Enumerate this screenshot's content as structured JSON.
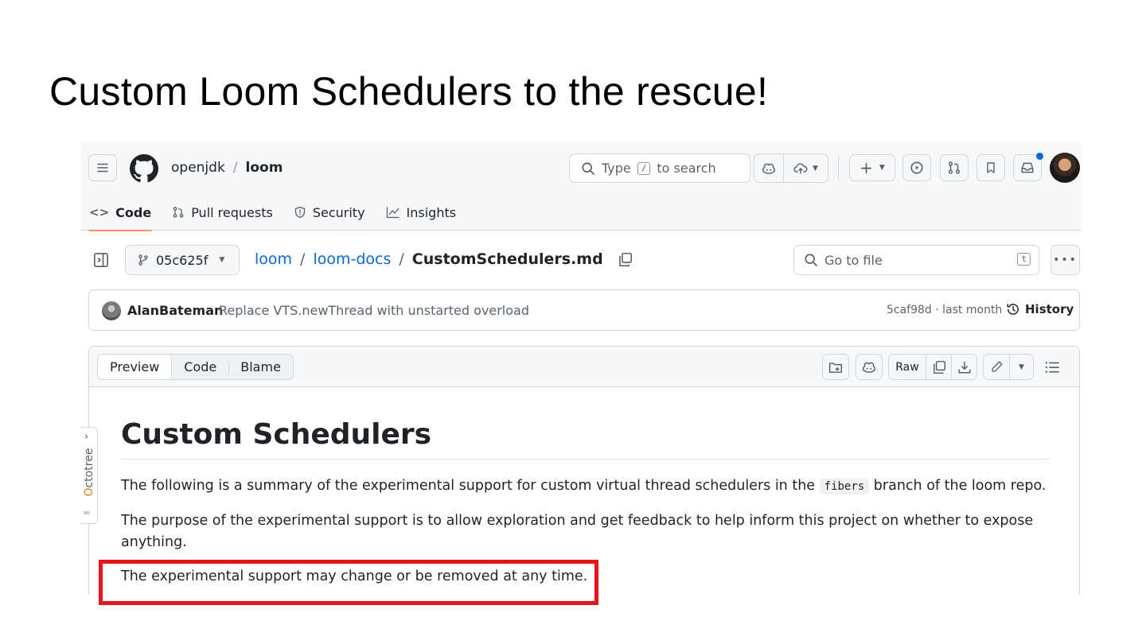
{
  "slide": {
    "title": "Custom Loom Schedulers to the rescue!"
  },
  "header": {
    "org": "openjdk",
    "crumb_sep": "/",
    "repo": "loom",
    "search_prefix": "Type",
    "search_key": "/",
    "search_suffix": "to search"
  },
  "nav": {
    "tabs": [
      {
        "label": "Code",
        "icon": "code-icon",
        "active": true
      },
      {
        "label": "Pull requests",
        "icon": "pull-request-icon"
      },
      {
        "label": "Security",
        "icon": "shield-icon"
      },
      {
        "label": "Insights",
        "icon": "graph-icon"
      }
    ]
  },
  "file_bar": {
    "branch": "05c625f",
    "path": [
      "loom",
      "loom-docs"
    ],
    "path_sep": "/",
    "file": "CustomSchedulers.md",
    "goto_placeholder": "Go to file",
    "goto_key": "t"
  },
  "commit": {
    "author": "AlanBateman",
    "message": "Replace VTS.newThread with unstarted overload",
    "meta": "5caf98d · last month",
    "history_label": "History"
  },
  "viewer": {
    "tabs": [
      "Preview",
      "Code",
      "Blame"
    ],
    "active_tab": "Preview",
    "raw_label": "Raw"
  },
  "doc": {
    "heading": "Custom Schedulers",
    "p1_before": "The following is a summary of the experimental support for custom virtual thread schedulers in the",
    "p1_code": "fibers",
    "p1_after": "branch of the loom repo.",
    "p2": "The purpose of the experimental support is to allow exploration and get feedback to help inform this project on whether to expose anything.",
    "p3": "The experimental support may change or be removed at any time."
  },
  "octotree": {
    "label_first": "O",
    "label_rest": "ctotree"
  },
  "colors": {
    "highlight": "#e8141c",
    "link": "#0969da",
    "active_tab_underline": "#fd8c73",
    "notification_dot": "#0969da"
  }
}
